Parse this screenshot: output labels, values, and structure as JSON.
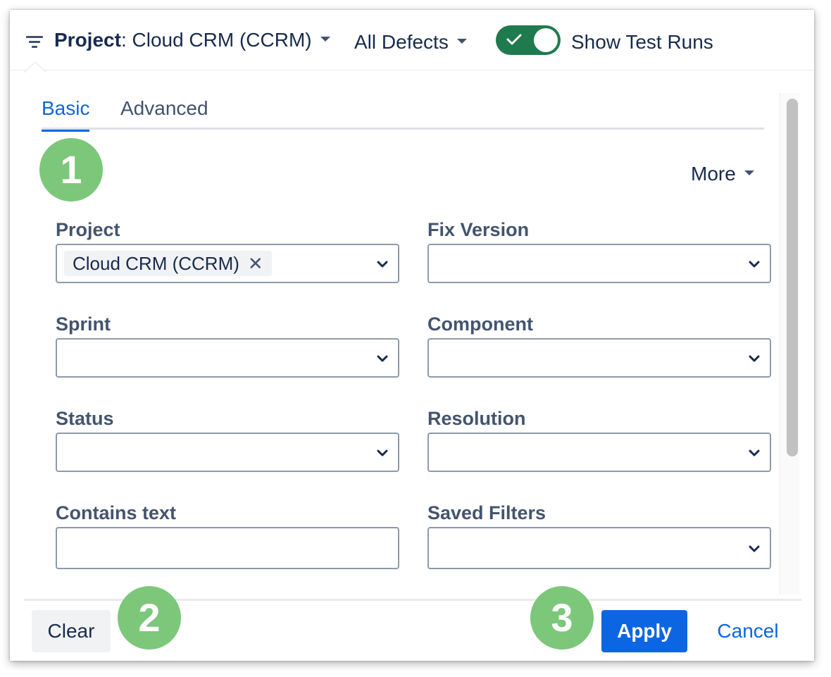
{
  "toolbar": {
    "filter_icon": "filter-lines-icon",
    "project_label": "Project",
    "project_value": ": Cloud CRM (CCRM)",
    "defects_label": "All Defects",
    "toggle_on": true,
    "toggle_label": "Show Test Runs"
  },
  "tabs": [
    {
      "label": "Basic",
      "active": true
    },
    {
      "label": "Advanced",
      "active": false
    }
  ],
  "more_label": "More",
  "fields": {
    "project": {
      "label": "Project",
      "chip": "Cloud CRM (CCRM)",
      "chip_remove": "✕"
    },
    "fix_version": {
      "label": "Fix Version"
    },
    "sprint": {
      "label": "Sprint"
    },
    "component": {
      "label": "Component"
    },
    "status": {
      "label": "Status"
    },
    "resolution": {
      "label": "Resolution"
    },
    "contains_text": {
      "label": "Contains text",
      "value": ""
    },
    "saved_filters": {
      "label": "Saved Filters"
    }
  },
  "badges": {
    "one": "1",
    "two": "2",
    "three": "3"
  },
  "buttons": {
    "clear": "Clear",
    "apply": "Apply",
    "cancel": "Cancel"
  },
  "colors": {
    "accent": "#0c66e4",
    "toggle": "#1f7a4d",
    "badge": "#7cc77a",
    "text": "#172b4d",
    "label": "#44546f"
  }
}
